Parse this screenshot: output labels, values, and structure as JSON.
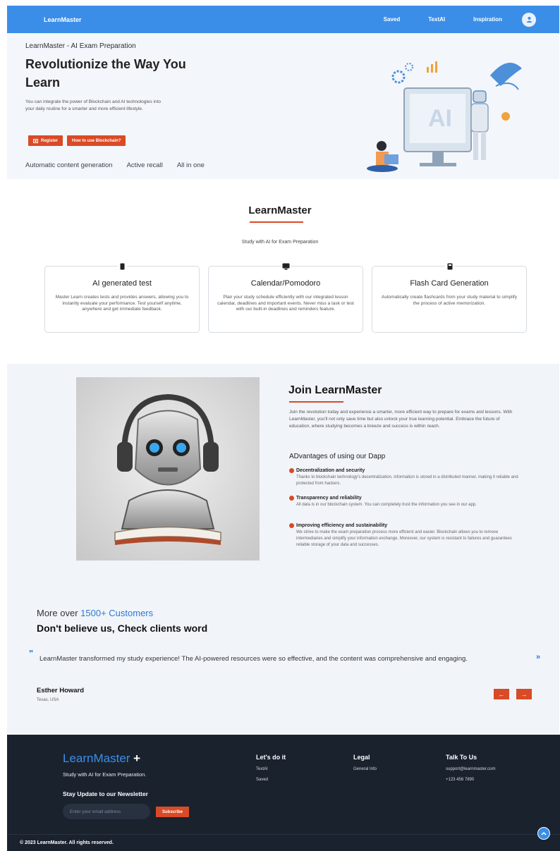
{
  "nav": {
    "brand": "LearnMaster",
    "links": [
      "Saved",
      "TextAI",
      "Inspiration"
    ]
  },
  "hero": {
    "kicker": "LearnMaster - AI Exam Preparation",
    "title": "Revolutionize the Way You Learn",
    "description": "You can integrate the power of Blockchain and AI technologies into your daily routine for a smarter and more efficient lifestyle.",
    "register_label": "Register",
    "blockchain_label": "How to use Blockchain?",
    "tags": [
      "Automatic content generation",
      "Active recall",
      "All in one"
    ],
    "illustration_text": "AI"
  },
  "features": {
    "title": "LearnMaster",
    "subtitle": "Study with AI for Exam Preparation",
    "cards": [
      {
        "title": "AI generated test",
        "desc": "Master Learn creates tests and provides answers, allowing you to instantly evaluate your performance. Test yourself anytime, anywhere and get immediate feedback."
      },
      {
        "title": "Calendar/Pomodoro",
        "desc": "Plan your study schedule efficiently with our integrated lesson calendar, deadlines and important events. Never miss a task or test with our built-in deadlines and reminders feature."
      },
      {
        "title": "Flash Card Generation",
        "desc": "Automatically create flashcards from your study material to simplify the process of active memorization."
      }
    ]
  },
  "join": {
    "title": "Join LearnMaster",
    "intro": "Join the revolution today and experience a smarter, more efficient way to prepare for exams and lessons. With LearnMaster, you'll not only save time but also unlock your true learning potential. Embrace the future of education, where studying becomes a breeze and success is within reach.",
    "advantages_title": "ADvantages of using our Dapp",
    "advantages": [
      {
        "title": "Decentralization and security",
        "body": "Thanks to blockchain technology's decentralization, information is stored in a distributed manner, making it reliable and protected from hackers."
      },
      {
        "title": "Transparency and reliability",
        "body": "All data is in our blockchain system. You can completely trust the information you see in our app."
      },
      {
        "title": "Improving efficiency and sustainability",
        "body": "We strive to make the exam preparation process more efficient and easier. Blockchain allows you to remove intermediaries and simplify your information exchange. Moreover, our system is resistant to failures and guarantees reliable storage of your data and successes."
      }
    ]
  },
  "testimonials": {
    "count_prefix": "More over",
    "count_highlight": "1500+ Customers",
    "heading": "Don't believe us, Check clients word",
    "quote": "LearnMaster transformed my study experience! The AI-powered resources were so effective, and the content was comprehensive and engaging.",
    "author": "Esther Howard",
    "location": "Texas, USA"
  },
  "footer": {
    "logo": "LearnMaster",
    "logo_plus": "+",
    "tagline": "Study with AI for Exam Preparation.",
    "newsletter_title": "Stay Update to our Newsletter",
    "email_placeholder": "Enter your email address",
    "subscribe_label": "Subscribe",
    "col1_title": "Let's do it",
    "col1_items": [
      "TextAI",
      "Saved"
    ],
    "col2_title": "Legal",
    "col2_items": [
      "General Info"
    ],
    "col3_title": "Talk To Us",
    "col3_items": [
      "support@learnmaster.com",
      "+123 456 7890"
    ],
    "copyright": "© 2023 LearnMaster. All rights reserved."
  },
  "colors": {
    "accent_blue": "#3b8ee8",
    "accent_red": "#d94a26",
    "footer_bg": "#1a222e"
  }
}
